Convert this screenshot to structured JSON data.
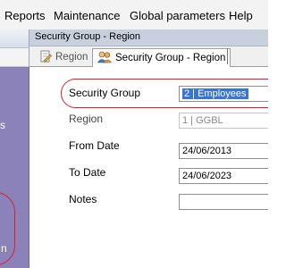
{
  "menubar": {
    "items": [
      "Reports",
      "Maintenance",
      "Global parameters",
      "Help"
    ]
  },
  "left_panel": {
    "fragment_1": "s",
    "fragment_2": "n"
  },
  "window": {
    "title": "Security Group  -  Region"
  },
  "tabs": [
    {
      "label": "Region",
      "icon": "pencil-icon",
      "active": false
    },
    {
      "label": "Security Group  -  Region",
      "icon": "users-icon",
      "active": true
    }
  ],
  "form": {
    "security_group": {
      "label": "Security Group",
      "value": "2  |  Employees"
    },
    "region": {
      "label": "Region",
      "value": "1  |  GGBL"
    },
    "from_date": {
      "label": "From Date",
      "value": "24/06/2013"
    },
    "to_date": {
      "label": "To Date",
      "value": "24/06/2023"
    },
    "notes": {
      "label": "Notes",
      "value": ""
    }
  },
  "colors": {
    "highlight": "#d81f2a",
    "selection": "#3875d7",
    "left_panel": "#8b82b9"
  }
}
